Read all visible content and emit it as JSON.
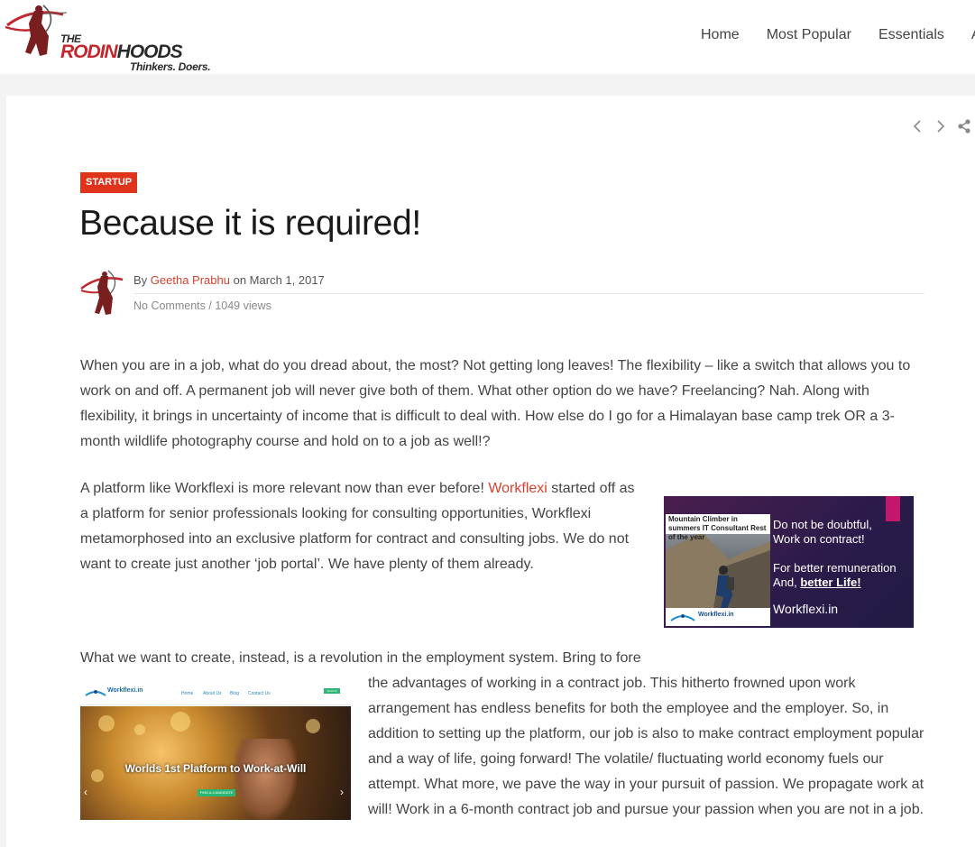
{
  "header": {
    "logo": {
      "the": "THE",
      "name_part1": "RODIN",
      "name_part2": "HOODS",
      "tagline": "Thinkers. Doers."
    },
    "nav": [
      "Home",
      "Most Popular",
      "Essentials",
      "A"
    ]
  },
  "post_nav": {
    "prev_icon": "chevron-left-icon",
    "next_icon": "chevron-right-icon",
    "share_icon": "share-icon"
  },
  "post": {
    "category": "STARTUP",
    "title": "Because it is required!",
    "meta": {
      "by": "By",
      "author": "Geetha Prabhu",
      "on": "on March 1, 2017",
      "comments": "No Comments",
      "separator": " / ",
      "views": "1049 views"
    },
    "p1": "When you are in a job, what do you dread about, the most? Not getting long leaves! The flexibility – like a switch that allows you to work on and off. A permanent job will never give both of them. What other option do we have? Freelancing? Nah. Along with flexibility, it brings in uncertainty of income that is difficult to deal with. How else do I go for a Himalayan base camp trek OR a 3-month wildlife photography course and hold on to a job as well!?",
    "p2_before": "A platform like Workflexi is more relevant now than ever before! ",
    "p2_link": "Workflexi",
    "p2_after": " started off as a platform for senior professionals looking for consulting opportunities, Workflexi metamorphosed into an exclusive platform for contract and consulting jobs. We do not want to create just another ‘job portal’. We have plenty of them already.",
    "p3_first_line": "What we want to create, instead, is a revolution in the employment system. Bring to fore",
    "p3_rest": "the advantages of working in a contract job. This hitherto frowned upon work arrangement has endless benefits for both the employee and the employer. So, in addition to setting up the platform, our job is also to make contract employment popular and a way of life, going forward! The volatile/ fluctuating world economy fuels our attempt. What more, we pave the way in your pursuit of passion. We propagate work at will! Work in a 6-month contract job and pursue your passion when you are not in a job."
  },
  "ad_image": {
    "caption": "Mountain Climber in summers IT Consultant Rest of the year",
    "line1": "Do not be doubtful,",
    "line2": "Work on contract!",
    "line3": "For better remuneration",
    "line4_prefix": "And, ",
    "line4_bold": "better Life!",
    "site": "Workflexi.in",
    "logo_text": "Workflexi.in"
  },
  "site_screenshot": {
    "logo": "Workflexi.in",
    "menu": [
      "Home",
      "About Us",
      "Blog",
      "Contact Us"
    ],
    "signin": "SIGN IN",
    "headline": "Worlds 1st Platform to Work-at-Will",
    "cta": "FIND A CANDIDATE",
    "left_arrow": "‹",
    "right_arrow": "›"
  },
  "colors": {
    "accent": "#e0331b",
    "link": "#d0442f",
    "brand_red": "#c2272d"
  }
}
